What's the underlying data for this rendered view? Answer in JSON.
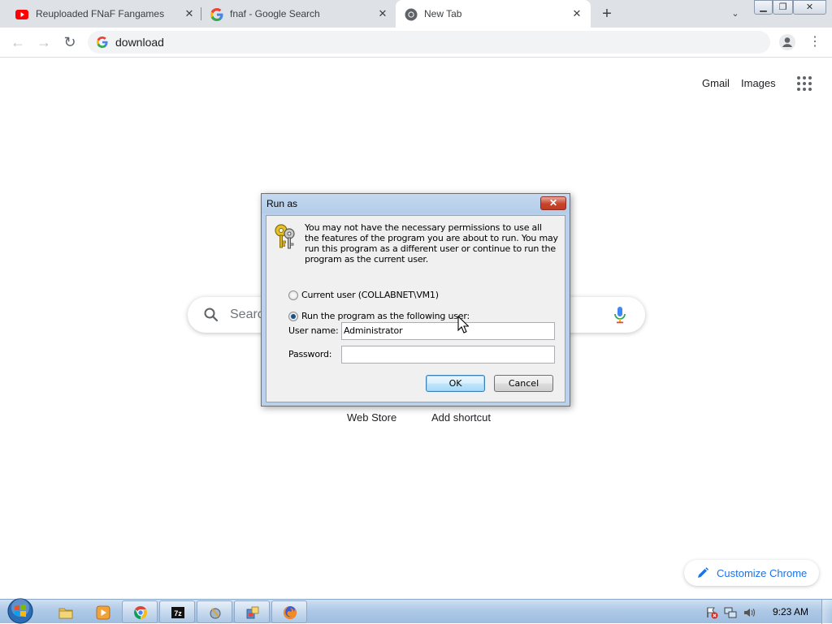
{
  "browser": {
    "tabs": [
      {
        "title": "Reuploaded FNaF Fangames - Yo",
        "favicon": "youtube-icon",
        "active": false
      },
      {
        "title": "fnaf - Google Search",
        "favicon": "google-icon",
        "active": false
      },
      {
        "title": "New Tab",
        "favicon": "chrome-icon",
        "active": true
      }
    ],
    "address_bar": {
      "value": "download"
    },
    "colors": {
      "tabstrip": "#dee1e6",
      "accent": "#1a73e8"
    }
  },
  "ntp": {
    "header_links": {
      "gmail": "Gmail",
      "images": "Images"
    },
    "search_placeholder": "Search",
    "shortcuts": {
      "web_store": "Web Store",
      "add_shortcut": "Add shortcut"
    },
    "customize_label": "Customize Chrome"
  },
  "dialog": {
    "title": "Run as",
    "message": "You may not have the necessary permissions to use all the features of the program you are about to run. You may run this program as a different user or continue to run the program as the current user.",
    "options": {
      "current_user": "Current user (COLLABNET\\VM1)",
      "other_user": "Run the program as the following user:",
      "selected": "other_user"
    },
    "username_label": "User name:",
    "username_value": "Administrator",
    "password_label": "Password:",
    "password_value": "",
    "ok_label": "OK",
    "cancel_label": "Cancel"
  },
  "taskbar": {
    "pinned": [
      "explorer-icon",
      "media-player-icon",
      "chrome-icon",
      "7zip-icon",
      "tool-icon",
      "installer-icon",
      "firefox-icon"
    ],
    "clock": "9:23 AM"
  }
}
